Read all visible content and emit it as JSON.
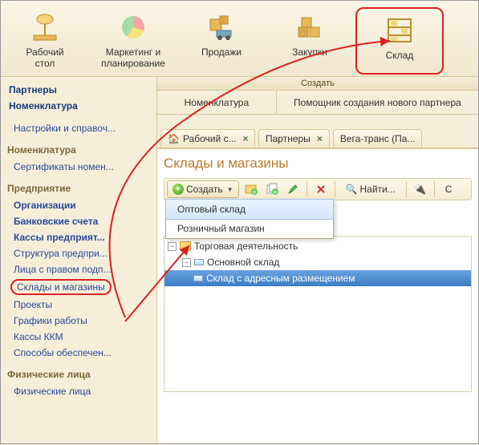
{
  "topbar": {
    "items": [
      {
        "label": "Рабочий\nстол"
      },
      {
        "label": "Маркетинг и\nпланирование"
      },
      {
        "label": "Продажи"
      },
      {
        "label": "Закупки"
      },
      {
        "label": "Склад"
      }
    ]
  },
  "sidebar": {
    "partners": "Партнеры",
    "nomenklatura_dark": "Номенклатура",
    "settings_link": "Настройки и справоч...",
    "nomenklatura_title": "Номенклатура",
    "cert_link": "Сертификаты номен...",
    "enterprise_title": "Предприятие",
    "enterprise_items": [
      "Организации",
      "Банковские счета",
      "Кассы предприят...",
      "Структура предпри...",
      "Лица с правом подп..."
    ],
    "warehouses": "Склады и магазины",
    "after": [
      "Проекты",
      "Графики работы",
      "Кассы ККМ",
      "Способы обеспечен..."
    ],
    "phys_title": "Физические лица",
    "phys_link": "Физические лица"
  },
  "create": {
    "title": "Создать",
    "left": "Номенклатура",
    "right": "Помощник создания нового партнера"
  },
  "tabs": [
    {
      "label": "Рабочий с..."
    },
    {
      "label": "Партнеры"
    },
    {
      "label": "Вега-транс (Па..."
    }
  ],
  "page": {
    "title": "Склады и магазины",
    "create_btn": "Создать",
    "find_btn": "Найти...",
    "c_btn": "С"
  },
  "dropdown": {
    "items": [
      "Оптовый склад",
      "Розничный магазин"
    ]
  },
  "tree": {
    "root": "Торговая деятельность",
    "child1": "Основной склад",
    "child2": "Склад с адресным размещением"
  }
}
